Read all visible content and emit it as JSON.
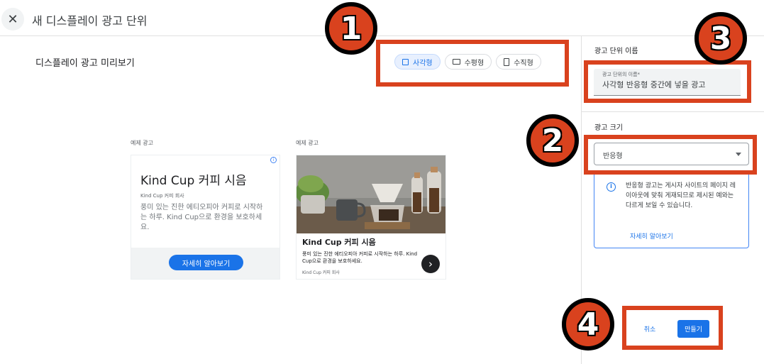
{
  "header": {
    "close_icon": "close-icon",
    "title": "새 디스플레이 광고 단위"
  },
  "preview": {
    "title": "디스플레이 광고 미리보기",
    "formats": [
      {
        "label": "사각형",
        "icon": "square-icon",
        "active": true
      },
      {
        "label": "수평형",
        "icon": "landscape-icon",
        "active": false
      },
      {
        "label": "수직형",
        "icon": "portrait-icon",
        "active": false
      }
    ]
  },
  "ad1": {
    "label": "예제 광고",
    "title": "Kind Cup 커피 시음",
    "company": "Kind Cup 커피 회사",
    "description": "풍미 있는 진한 에티오피아 커피로 시작하는 하루. Kind Cup으로 환경을 보호하세요.",
    "cta": "자세히 알아보기",
    "info_icon": "adchoices-info-icon"
  },
  "ad2": {
    "label": "예제 광고",
    "title": "Kind Cup 커피 시음",
    "description": "풍미 있는 진한 에티오피아 커피로 시작하는 하루. Kind Cup으로 환경을 보호하세요.",
    "company": "Kind Cup 커피 회사",
    "arrow_icon": "chevron-right-icon"
  },
  "settings": {
    "name_section_label": "광고 단위 이름",
    "name_field_label": "광고 단위의 이름*",
    "name_field_value": "사각형 반응형 중간에 넣을 광고",
    "size_section_label": "광고 크기",
    "size_value": "반응형",
    "notice_text": "반응형 광고는 게시자 사이트의 페이지 레이아웃에 맞춰 게재되므로 제시된 예와는 다르게 보일 수 있습니다.",
    "notice_link": "자세히 알아보기"
  },
  "actions": {
    "cancel": "취소",
    "create": "만들기"
  },
  "annotations": [
    "1",
    "2",
    "3",
    "4"
  ],
  "colors": {
    "accent": "#1a73e8",
    "annotation": "#d9421e"
  }
}
